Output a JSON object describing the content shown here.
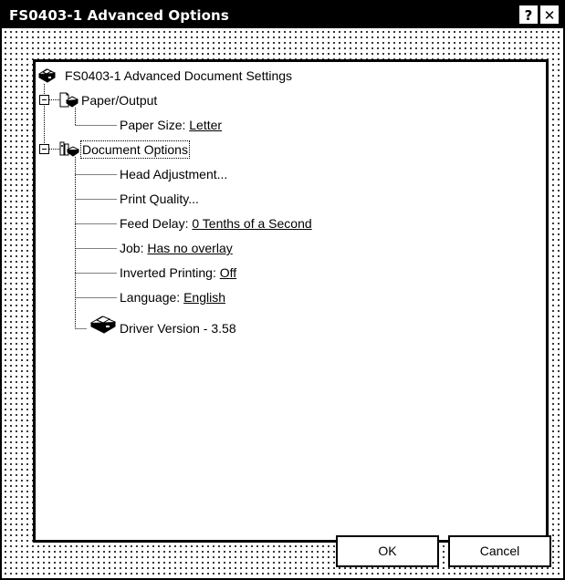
{
  "window": {
    "title": "FS0403-1 Advanced Options",
    "help_button": "?",
    "close_button": "✕"
  },
  "tree": {
    "root": {
      "label": "FS0403-1 Advanced Document Settings",
      "icon": "printer-icon"
    },
    "paper_output": {
      "label": "Paper/Output",
      "icon": "paper-output-icon",
      "expander": "−",
      "items": [
        {
          "label": "Paper Size:",
          "value": "Letter"
        }
      ]
    },
    "document_options": {
      "label": "Document Options",
      "icon": "document-options-icon",
      "expander": "−",
      "items": [
        {
          "label": "Head Adjustment...",
          "value": ""
        },
        {
          "label": "Print Quality...",
          "value": ""
        },
        {
          "label": "Feed Delay:",
          "value": "0 Tenths of a Second"
        },
        {
          "label": "Job:",
          "value": "Has no overlay"
        },
        {
          "label": "Inverted Printing:",
          "value": "Off"
        },
        {
          "label": "Language:",
          "value": "English"
        }
      ]
    },
    "driver_version": {
      "label": "Driver Version - 3.58",
      "icon": "printer-icon"
    }
  },
  "buttons": {
    "ok": "OK",
    "cancel": "Cancel"
  }
}
